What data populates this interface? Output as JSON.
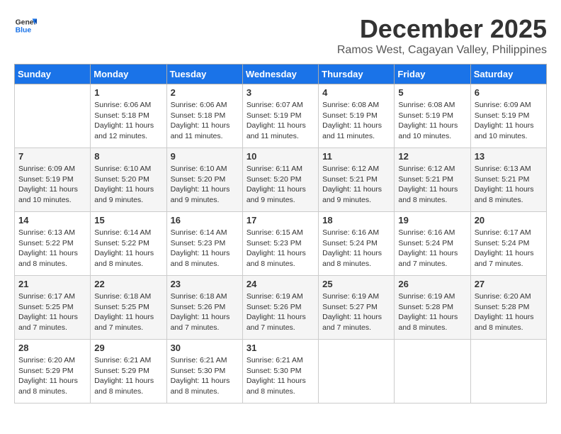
{
  "logo": {
    "line1": "General",
    "line2": "Blue"
  },
  "title": {
    "month": "December 2025",
    "location": "Ramos West, Cagayan Valley, Philippines"
  },
  "headers": [
    "Sunday",
    "Monday",
    "Tuesday",
    "Wednesday",
    "Thursday",
    "Friday",
    "Saturday"
  ],
  "weeks": [
    [
      {
        "day": "",
        "info": ""
      },
      {
        "day": "1",
        "info": "Sunrise: 6:06 AM\nSunset: 5:18 PM\nDaylight: 11 hours\nand 12 minutes."
      },
      {
        "day": "2",
        "info": "Sunrise: 6:06 AM\nSunset: 5:18 PM\nDaylight: 11 hours\nand 11 minutes."
      },
      {
        "day": "3",
        "info": "Sunrise: 6:07 AM\nSunset: 5:19 PM\nDaylight: 11 hours\nand 11 minutes."
      },
      {
        "day": "4",
        "info": "Sunrise: 6:08 AM\nSunset: 5:19 PM\nDaylight: 11 hours\nand 11 minutes."
      },
      {
        "day": "5",
        "info": "Sunrise: 6:08 AM\nSunset: 5:19 PM\nDaylight: 11 hours\nand 10 minutes."
      },
      {
        "day": "6",
        "info": "Sunrise: 6:09 AM\nSunset: 5:19 PM\nDaylight: 11 hours\nand 10 minutes."
      }
    ],
    [
      {
        "day": "7",
        "info": "Sunrise: 6:09 AM\nSunset: 5:19 PM\nDaylight: 11 hours\nand 10 minutes."
      },
      {
        "day": "8",
        "info": "Sunrise: 6:10 AM\nSunset: 5:20 PM\nDaylight: 11 hours\nand 9 minutes."
      },
      {
        "day": "9",
        "info": "Sunrise: 6:10 AM\nSunset: 5:20 PM\nDaylight: 11 hours\nand 9 minutes."
      },
      {
        "day": "10",
        "info": "Sunrise: 6:11 AM\nSunset: 5:20 PM\nDaylight: 11 hours\nand 9 minutes."
      },
      {
        "day": "11",
        "info": "Sunrise: 6:12 AM\nSunset: 5:21 PM\nDaylight: 11 hours\nand 9 minutes."
      },
      {
        "day": "12",
        "info": "Sunrise: 6:12 AM\nSunset: 5:21 PM\nDaylight: 11 hours\nand 8 minutes."
      },
      {
        "day": "13",
        "info": "Sunrise: 6:13 AM\nSunset: 5:21 PM\nDaylight: 11 hours\nand 8 minutes."
      }
    ],
    [
      {
        "day": "14",
        "info": "Sunrise: 6:13 AM\nSunset: 5:22 PM\nDaylight: 11 hours\nand 8 minutes."
      },
      {
        "day": "15",
        "info": "Sunrise: 6:14 AM\nSunset: 5:22 PM\nDaylight: 11 hours\nand 8 minutes."
      },
      {
        "day": "16",
        "info": "Sunrise: 6:14 AM\nSunset: 5:23 PM\nDaylight: 11 hours\nand 8 minutes."
      },
      {
        "day": "17",
        "info": "Sunrise: 6:15 AM\nSunset: 5:23 PM\nDaylight: 11 hours\nand 8 minutes."
      },
      {
        "day": "18",
        "info": "Sunrise: 6:16 AM\nSunset: 5:24 PM\nDaylight: 11 hours\nand 8 minutes."
      },
      {
        "day": "19",
        "info": "Sunrise: 6:16 AM\nSunset: 5:24 PM\nDaylight: 11 hours\nand 7 minutes."
      },
      {
        "day": "20",
        "info": "Sunrise: 6:17 AM\nSunset: 5:24 PM\nDaylight: 11 hours\nand 7 minutes."
      }
    ],
    [
      {
        "day": "21",
        "info": "Sunrise: 6:17 AM\nSunset: 5:25 PM\nDaylight: 11 hours\nand 7 minutes."
      },
      {
        "day": "22",
        "info": "Sunrise: 6:18 AM\nSunset: 5:25 PM\nDaylight: 11 hours\nand 7 minutes."
      },
      {
        "day": "23",
        "info": "Sunrise: 6:18 AM\nSunset: 5:26 PM\nDaylight: 11 hours\nand 7 minutes."
      },
      {
        "day": "24",
        "info": "Sunrise: 6:19 AM\nSunset: 5:26 PM\nDaylight: 11 hours\nand 7 minutes."
      },
      {
        "day": "25",
        "info": "Sunrise: 6:19 AM\nSunset: 5:27 PM\nDaylight: 11 hours\nand 7 minutes."
      },
      {
        "day": "26",
        "info": "Sunrise: 6:19 AM\nSunset: 5:28 PM\nDaylight: 11 hours\nand 8 minutes."
      },
      {
        "day": "27",
        "info": "Sunrise: 6:20 AM\nSunset: 5:28 PM\nDaylight: 11 hours\nand 8 minutes."
      }
    ],
    [
      {
        "day": "28",
        "info": "Sunrise: 6:20 AM\nSunset: 5:29 PM\nDaylight: 11 hours\nand 8 minutes."
      },
      {
        "day": "29",
        "info": "Sunrise: 6:21 AM\nSunset: 5:29 PM\nDaylight: 11 hours\nand 8 minutes."
      },
      {
        "day": "30",
        "info": "Sunrise: 6:21 AM\nSunset: 5:30 PM\nDaylight: 11 hours\nand 8 minutes."
      },
      {
        "day": "31",
        "info": "Sunrise: 6:21 AM\nSunset: 5:30 PM\nDaylight: 11 hours\nand 8 minutes."
      },
      {
        "day": "",
        "info": ""
      },
      {
        "day": "",
        "info": ""
      },
      {
        "day": "",
        "info": ""
      }
    ]
  ]
}
